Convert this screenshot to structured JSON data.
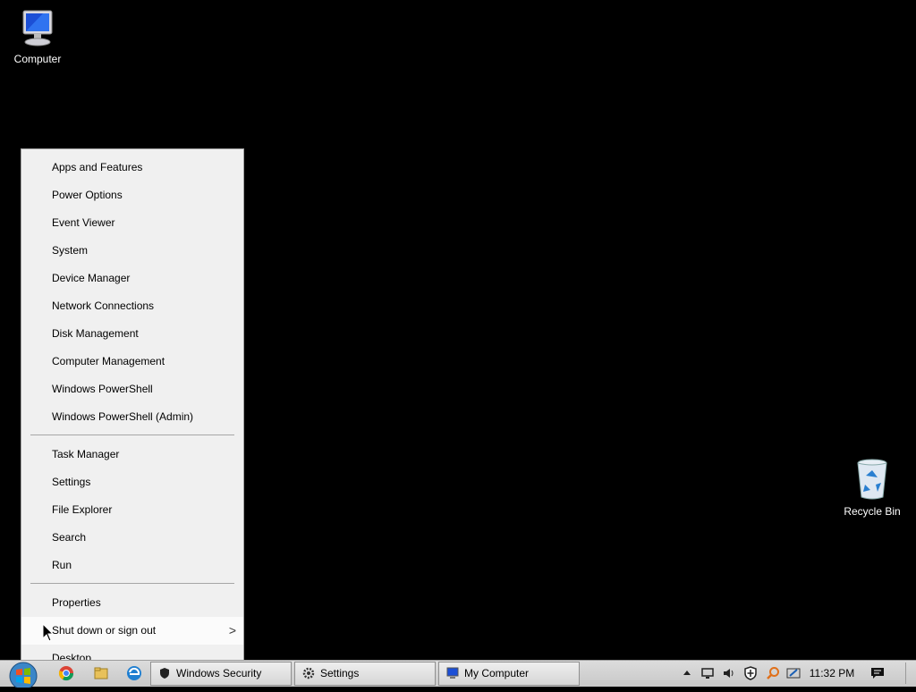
{
  "desktop": {
    "icons": [
      {
        "label": "Computer",
        "icon": "computer-icon"
      },
      {
        "label": "Recycle Bin",
        "icon": "recycle-bin-icon"
      }
    ]
  },
  "menu": {
    "group1": [
      "Apps and Features",
      "Power Options",
      "Event Viewer",
      "System",
      "Device Manager",
      "Network Connections",
      "Disk Management",
      "Computer Management",
      "Windows PowerShell",
      "Windows PowerShell (Admin)"
    ],
    "group2": [
      "Task Manager",
      "Settings",
      "File Explorer",
      "Search",
      "Run"
    ],
    "group3": [
      "Properties",
      "Shut down or sign out",
      "Desktop"
    ],
    "submenu_arrow": ">"
  },
  "taskbar": {
    "start_icon": "windows-start-orb-icon",
    "quick_launch": [
      "chrome-icon",
      "file-explorer-icon",
      "edge-icon"
    ],
    "buttons": [
      {
        "label": "Windows Security",
        "icon": "shield-icon"
      },
      {
        "label": "Settings",
        "icon": "gear-icon"
      },
      {
        "label": "My Computer",
        "icon": "computer-icon"
      }
    ],
    "tray": [
      "chevron-up-icon",
      "network-icon",
      "volume-icon",
      "security-shield-icon",
      "search-icon",
      "pen-icon"
    ],
    "clock": "11:32 PM",
    "notification_icon": "action-center-icon"
  }
}
